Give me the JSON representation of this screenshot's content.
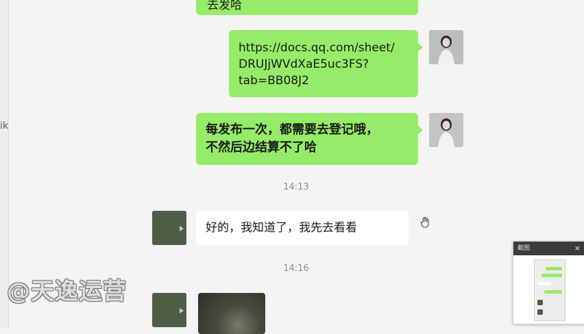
{
  "messages": {
    "top_partial": "去发哈",
    "link_lines": [
      "https://docs.qq.com/sheet/",
      "DRUJjWVdXaE5uc3FS?",
      "tab=BB08J2"
    ],
    "notice_lines": [
      "每发布一次，都需要去登记哦，",
      "不然后边结算不了哈"
    ],
    "reply": "好的，我知道了，我先去看看"
  },
  "timestamps": [
    "14:13",
    "14:16"
  ],
  "watermark": "@天逸运营",
  "left_edge_glyph": "ik",
  "mini_window": {
    "title": "截图",
    "close": "×"
  },
  "colors": {
    "bubble_green": "#95ec69",
    "background": "#f4f4f4",
    "timestamp": "#8f8f8f"
  },
  "icons": [
    "female-avatar",
    "male-avatar",
    "hand-cursor-icon",
    "close-icon"
  ]
}
